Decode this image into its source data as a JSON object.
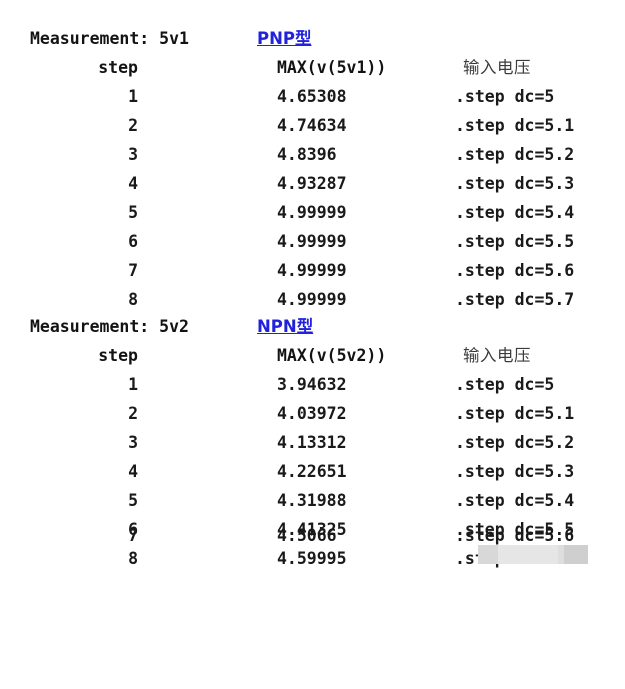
{
  "document": {
    "kind": "simulation-measurement-output",
    "background_color": "#ffffff",
    "text_color": "#131313",
    "accent_color": "#2222dd",
    "annotation_color": "#3c3c3c"
  },
  "sections": [
    {
      "measurement_label": "Measurement: 5v1",
      "type_tag": "PNP型",
      "headers": {
        "step": "step",
        "value": "MAX(v(5v1))",
        "note": "输入电压"
      },
      "rows": [
        {
          "step": "1",
          "value": "4.65308",
          "note": ".step dc=5"
        },
        {
          "step": "2",
          "value": "4.74634",
          "note": ".step dc=5.1"
        },
        {
          "step": "3",
          "value": "4.8396",
          "note": ".step dc=5.2"
        },
        {
          "step": "4",
          "value": "4.93287",
          "note": ".step dc=5.3"
        },
        {
          "step": "5",
          "value": "4.99999",
          "note": ".step dc=5.4"
        },
        {
          "step": "6",
          "value": "4.99999",
          "note": ".step dc=5.5"
        },
        {
          "step": "7",
          "value": "4.99999",
          "note": ".step dc=5.6"
        },
        {
          "step": "8",
          "value": "4.99999",
          "note": ".step dc=5.7"
        }
      ]
    },
    {
      "measurement_label": "Measurement: 5v2",
      "type_tag": "NPN型",
      "headers": {
        "step": "step",
        "value": "MAX(v(5v2))",
        "note": "输入电压"
      },
      "rows": [
        {
          "step": "1",
          "value": "3.94632",
          "note": ".step dc=5"
        },
        {
          "step": "2",
          "value": "4.03972",
          "note": ".step dc=5.1"
        },
        {
          "step": "3",
          "value": "4.13312",
          "note": ".step dc=5.2"
        },
        {
          "step": "4",
          "value": "4.22651",
          "note": ".step dc=5.3"
        },
        {
          "step": "5",
          "value": "4.31988",
          "note": ".step dc=5.4"
        },
        {
          "step": "6",
          "value": "4.41325",
          "note": ".step dc=5.5"
        },
        {
          "step": "7",
          "value": "4.5066",
          "note": ".step dc=5.6"
        },
        {
          "step": "8",
          "value": "4.59995",
          "note": ".step dc=5.7"
        }
      ]
    }
  ]
}
